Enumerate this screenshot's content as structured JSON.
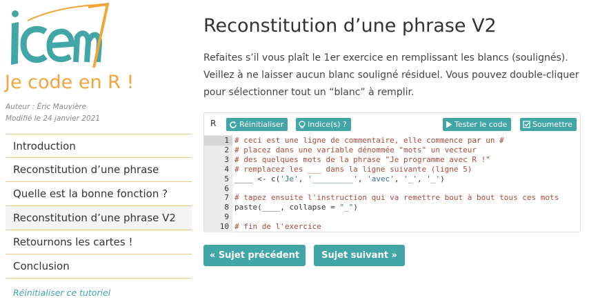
{
  "sidebar": {
    "logo_text": "icem",
    "site_title": "Je code en R !",
    "author": "Auteur : Éric Mauvière",
    "modified": "Modifié le 24 janvier 2021",
    "toc": [
      {
        "label": "Introduction",
        "active": false
      },
      {
        "label": "Reconstitution d’une phrase",
        "active": false
      },
      {
        "label": "Quelle est la bonne fonction ?",
        "active": false
      },
      {
        "label": "Reconstitution d’une phrase V2",
        "active": true
      },
      {
        "label": "Retournons les cartes !",
        "active": false
      },
      {
        "label": "Conclusion",
        "active": false
      }
    ],
    "reset_tutorial": "Réinitialiser ce tutoriel"
  },
  "main": {
    "title": "Reconstitution d’une phrase V2",
    "intro": "Refaites s’il vous plaît le 1er exercice en remplissant les blancs (soulignés). Veillez à ne laisser aucun blanc souligné résiduel. Vous pouvez double-cliquer pour sélectionner tout un “blanc” à remplir.",
    "exercise": {
      "language": "R",
      "buttons": {
        "reset": "Réinitialiser",
        "hint": "Indice(s) ?",
        "test": "Tester le code",
        "submit": "Soumettre"
      },
      "active_line": 1,
      "lines": [
        "# ceci est une ligne de commentaire, elle commence par un #",
        "# placez dans une variable dénommée \"mots\" un vecteur",
        "# des quelques mots de la phrase \"Je programme avec R !\"",
        "# remplacez les ___ dans la ligne suivante (ligne 5)",
        "____ <- c('Je', '_________', 'avec', '_', '_')",
        "",
        "# tapez ensuite l'instruction qui va remettre bout à bout tous ces mots",
        "paste(____, collapse = \"_\")",
        "",
        "# fin de l'exercice"
      ]
    },
    "prev_button": "« Sujet précédent",
    "next_button": "Sujet suivant »"
  },
  "colors": {
    "accent_teal": "#43a6a6",
    "accent_orange": "#f1a53b",
    "comment": "#aa4a3c",
    "string": "#36708f"
  },
  "icons": [
    "refresh-icon",
    "lightbulb-icon",
    "play-icon",
    "check-square-icon"
  ]
}
